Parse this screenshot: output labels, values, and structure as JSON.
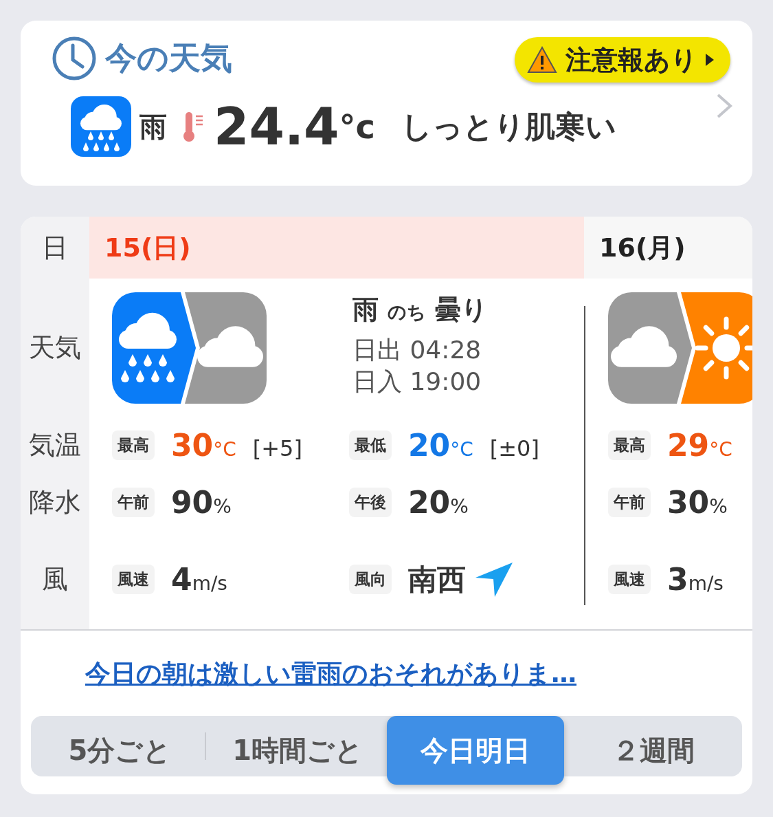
{
  "current": {
    "title": "今の天気",
    "alert": "注意報あり",
    "condition": "雨",
    "temperature": "24.4",
    "unit": "°c",
    "feeling": "しっとり肌寒い"
  },
  "forecast": {
    "row_labels": [
      "日",
      "天気",
      "気温",
      "降水",
      "風"
    ],
    "days": [
      {
        "date": "15(日)",
        "selected": true,
        "icon_halves": [
          {
            "kind": "rain"
          },
          {
            "kind": "cloudy"
          }
        ],
        "summary": [
          {
            "text": "雨",
            "kind": "main"
          },
          {
            "text": "のち",
            "kind": "joiner"
          },
          {
            "text": "曇り",
            "kind": "main"
          }
        ],
        "sun": [
          {
            "label": "日出",
            "value": "04:28"
          },
          {
            "label": "日入",
            "value": "19:00"
          }
        ],
        "temps": [
          {
            "label": "最高",
            "value": "30",
            "unit": "°C",
            "kind": "high",
            "diff": "[+5]"
          },
          {
            "label": "最低",
            "value": "20",
            "unit": "°C",
            "kind": "low",
            "diff": "[±0]"
          }
        ],
        "precip": [
          {
            "label": "午前",
            "value": "90",
            "unit": "%"
          },
          {
            "label": "午後",
            "value": "20",
            "unit": "%"
          }
        ],
        "wind": [
          {
            "label": "風速",
            "value": "4",
            "unit": "m/s",
            "kind": "speed"
          },
          {
            "label": "風向",
            "value": "南西",
            "kind": "direction"
          }
        ]
      },
      {
        "date": "16(月)",
        "selected": false,
        "icon_halves": [
          {
            "kind": "cloudy"
          },
          {
            "kind": "sunny"
          }
        ],
        "temps": [
          {
            "label": "最高",
            "value": "29",
            "unit": "°C",
            "kind": "high"
          }
        ],
        "precip": [
          {
            "label": "午前",
            "value": "30",
            "unit": "%"
          }
        ],
        "wind": [
          {
            "label": "風速",
            "value": "3",
            "unit": "m/s",
            "kind": "speed"
          }
        ]
      }
    ]
  },
  "comment_link": "今日の朝は激しい雷雨のおそれがありま…",
  "tabs": [
    {
      "label": "5分ごと",
      "selected": false
    },
    {
      "label": "1時間ごと",
      "selected": false
    },
    {
      "label": "今日明日",
      "selected": true
    },
    {
      "label": "２週間",
      "selected": false
    }
  ]
}
